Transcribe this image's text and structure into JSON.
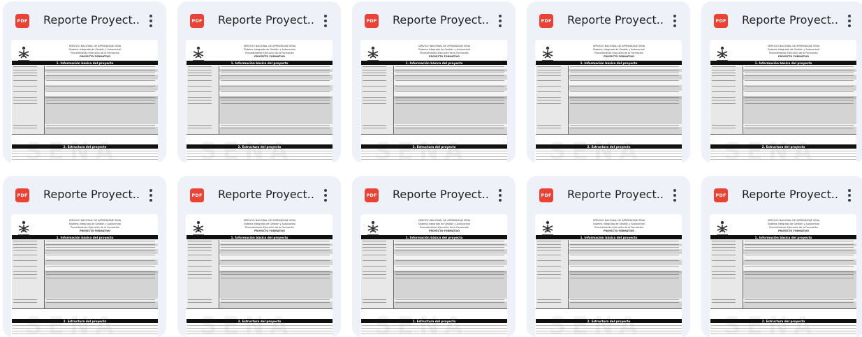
{
  "files": [
    {
      "title": "Reporte Proyect...",
      "type_badge": "PDF"
    },
    {
      "title": "Reporte Proyect...",
      "type_badge": "PDF"
    },
    {
      "title": "Reporte Proyect...",
      "type_badge": "PDF"
    },
    {
      "title": "Reporte Proyect...",
      "type_badge": "PDF"
    },
    {
      "title": "Reporte Proyect...",
      "type_badge": "PDF"
    },
    {
      "title": "Reporte Proyect...",
      "type_badge": "PDF"
    },
    {
      "title": "Reporte Proyect...",
      "type_badge": "PDF"
    },
    {
      "title": "Reporte Proyect...",
      "type_badge": "PDF"
    },
    {
      "title": "Reporte Proyect...",
      "type_badge": "PDF"
    },
    {
      "title": "Reporte Proyect...",
      "type_badge": "PDF"
    }
  ],
  "thumbnail": {
    "header_line1": "SERVICIO NACIONAL DE APRENDIZAJE SENA",
    "header_line2": "Sistema Integrado de Gestión y Autocontrol",
    "header_line3": "Procedimiento Ejecución de la Formación",
    "header_line4": "PROYECTO FORMATIVO",
    "section1": "1. Información básica del proyecto",
    "section2": "2. Estructura del proyecto"
  },
  "colors": {
    "card_bg": "#eef1f8",
    "pdf_badge": "#ea4335",
    "title_text": "#1f1f1f"
  },
  "icons": {
    "file_type": "pdf-icon",
    "menu": "more-vert-icon",
    "doc_logo": "sena-logo"
  }
}
